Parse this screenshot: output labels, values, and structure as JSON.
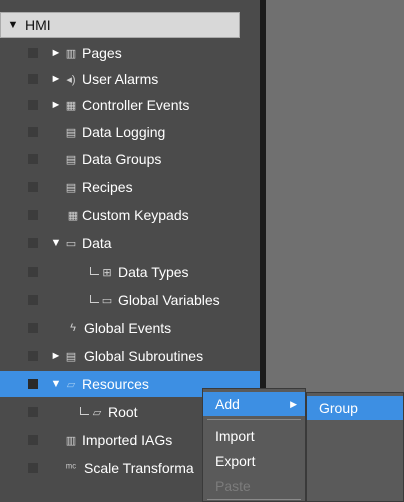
{
  "tree": {
    "root": {
      "label": "HMI",
      "toggle": "▼"
    },
    "items": [
      {
        "label": "Pages",
        "toggle": "►",
        "icon": "pages-icon",
        "glyph": "▥"
      },
      {
        "label": "User Alarms",
        "toggle": "►",
        "icon": "alarm-icon",
        "glyph": "◂)"
      },
      {
        "label": "Controller Events",
        "toggle": "►",
        "icon": "controller-events-icon",
        "glyph": "▦"
      },
      {
        "label": "Data Logging",
        "toggle": "",
        "icon": "data-logging-icon",
        "glyph": "▤"
      },
      {
        "label": "Data Groups",
        "toggle": "",
        "icon": "data-groups-icon",
        "glyph": "▤"
      },
      {
        "label": "Recipes",
        "toggle": "",
        "icon": "recipes-icon",
        "glyph": "▤"
      },
      {
        "label": "Custom Keypads",
        "toggle": "",
        "icon": "keypad-icon",
        "glyph": "▦"
      },
      {
        "label": "Data",
        "toggle": "▼",
        "icon": "data-folder-icon",
        "glyph": "▭"
      },
      {
        "label": "Data Types",
        "toggle": "",
        "icon": "data-types-icon",
        "glyph": "⊞"
      },
      {
        "label": "Global Variables",
        "toggle": "",
        "icon": "global-variables-icon",
        "glyph": "▭"
      },
      {
        "label": "Global Events",
        "toggle": "",
        "icon": "lightning-icon",
        "glyph": "ϟ"
      },
      {
        "label": "Global Subroutines",
        "toggle": "►",
        "icon": "subroutine-icon",
        "glyph": "▤"
      },
      {
        "label": "Resources",
        "toggle": "▼",
        "icon": "resources-folder-icon",
        "glyph": "▱"
      },
      {
        "label": "Root",
        "toggle": "",
        "icon": "root-folder-icon",
        "glyph": "▱"
      },
      {
        "label": "Imported IAGs",
        "toggle": "",
        "icon": "imported-iags-icon",
        "glyph": "▥"
      },
      {
        "label": "Scale Transforma",
        "toggle": "",
        "icon": "scale-transform-icon",
        "glyph": "ᵐᶜ"
      }
    ]
  },
  "context_menu": {
    "add": "Add",
    "add_arrow": "▶",
    "import": "Import",
    "export": "Export",
    "paste": "Paste"
  },
  "submenu": {
    "group": "Group"
  }
}
